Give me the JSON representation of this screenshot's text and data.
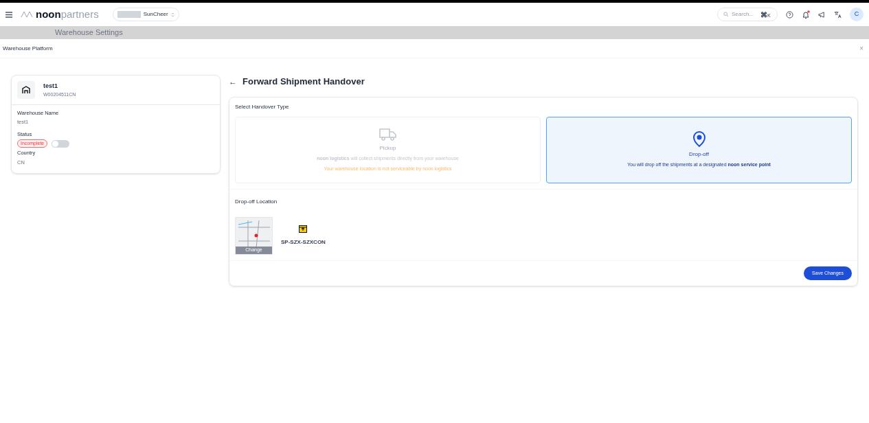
{
  "header": {
    "brand_bold": "noon",
    "brand_light": "partners",
    "store": "SunCheer",
    "search": {
      "placeholder": "Search...",
      "shortcut_symbol": "⌘",
      "shortcut_key": "K"
    },
    "notification_dot": true,
    "avatar": "C"
  },
  "background_bar": {
    "title": "Warehouse Settings"
  },
  "modal": {
    "title": "Warehouse Platform",
    "close": "×"
  },
  "warehouse": {
    "name": "test1",
    "code": "W00204511CN",
    "fields": [
      {
        "label": "Warehouse Name",
        "value": "test1",
        "kind": "text"
      },
      {
        "label": "Status",
        "value": "Incomplete",
        "kind": "status",
        "on": false
      },
      {
        "label": "Country",
        "value": "CN",
        "kind": "text"
      }
    ]
  },
  "page": {
    "back": "←",
    "title": "Forward Shipment Handover",
    "section_label": "Select Handover Type",
    "options": [
      {
        "kind": "pickup",
        "label": "Pickup",
        "selected": false,
        "disabled": true,
        "description": "**noon logistics** will collect shipments directly from your warehouse",
        "warning": "Your warehouse location is not serviceable by noon logistics"
      },
      {
        "kind": "dropoff",
        "label": "Drop-off",
        "selected": true,
        "disabled": false,
        "description": "You will drop off the shipments at a designated **noon service point**"
      }
    ],
    "location_label": "Drop-off Location",
    "map_button": "Change",
    "location_code": "SP-SZX-SZXCON",
    "save_button": "Save Changes"
  }
}
